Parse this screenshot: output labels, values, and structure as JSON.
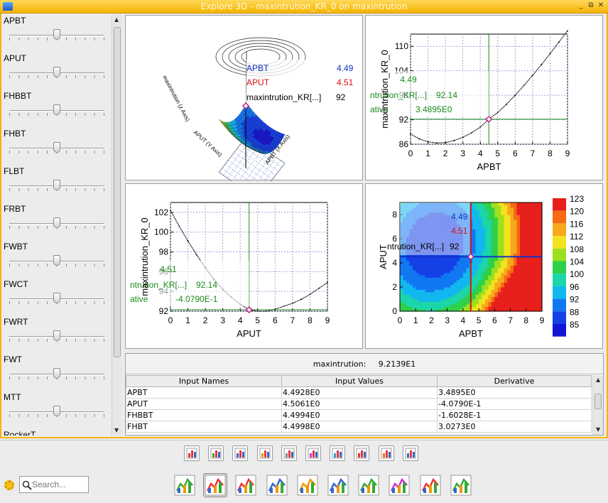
{
  "window": {
    "title": "Explore 3D - maxintrution_KR_0 on maxintrution",
    "accent": "#f5b400"
  },
  "sliders": [
    {
      "label": "APBT",
      "value_fraction": 0.5
    },
    {
      "label": "APUT",
      "value_fraction": 0.5
    },
    {
      "label": "FHBBT",
      "value_fraction": 0.5
    },
    {
      "label": "FHBT",
      "value_fraction": 0.5
    },
    {
      "label": "FLBT",
      "value_fraction": 0.5
    },
    {
      "label": "FRBT",
      "value_fraction": 0.5
    },
    {
      "label": "FWBT",
      "value_fraction": 0.5
    },
    {
      "label": "FWCT",
      "value_fraction": 0.5
    },
    {
      "label": "FWRT",
      "value_fraction": 0.5
    },
    {
      "label": "FWT",
      "value_fraction": 0.5
    },
    {
      "label": "MTT",
      "value_fraction": 0.5
    },
    {
      "label": "RockerT",
      "value_fraction": 0.5
    }
  ],
  "plot3d": {
    "axis_z": "maxintrution (z Axis)",
    "axis_y": "APUT (Y Axis)",
    "axis_x": "APBT (X Axis)",
    "tooltip": {
      "apbt_label": "APBT",
      "apbt_value": "4.49",
      "aput_label": "APUT",
      "aput_value": "4.51",
      "out_label": "maxintrution_KR[...]",
      "out_value": "92"
    }
  },
  "chart_data": [
    {
      "type": "line",
      "xlabel": "APBT",
      "ylabel": "maxintrution_KR_0",
      "xlim": [
        0,
        9
      ],
      "ylim": [
        86,
        113
      ],
      "xticks": [
        "0",
        "1",
        "2",
        "3",
        "4",
        "5",
        "6",
        "7",
        "8",
        "9"
      ],
      "yticks": [
        "86",
        "92",
        "98",
        "104",
        "110"
      ],
      "x": [
        0,
        0.5,
        1,
        1.5,
        2,
        2.5,
        3,
        3.5,
        4,
        4.49,
        5,
        5.5,
        6,
        6.5,
        7,
        7.5,
        8,
        8.5,
        9
      ],
      "y": [
        88.5,
        87.3,
        86.6,
        86.3,
        86.4,
        86.9,
        87.7,
        88.8,
        90.2,
        92.14,
        93.8,
        95.8,
        98.0,
        100.4,
        102.9,
        105.5,
        108.2,
        111.0,
        113.8
      ],
      "crosshair": {
        "x": 4.49,
        "y": 92.14
      },
      "annotation": {
        "top": "4.49",
        "middle_label": "ntrution_KR[...]",
        "middle_value": "92.14",
        "bottom_label": "ative",
        "bottom_value": "3.4895E0"
      }
    },
    {
      "type": "line",
      "xlabel": "APUT",
      "ylabel": "maxintrution_KR_0",
      "xlim": [
        0,
        9
      ],
      "ylim": [
        92,
        103
      ],
      "xticks": [
        "0",
        "1",
        "2",
        "3",
        "4",
        "5",
        "6",
        "7",
        "8",
        "9"
      ],
      "yticks": [
        "92",
        "94",
        "96",
        "98",
        "100",
        "102"
      ],
      "x": [
        0,
        0.5,
        1,
        1.5,
        2,
        2.5,
        3,
        3.5,
        4,
        4.51,
        5,
        5.5,
        6,
        6.5,
        7,
        7.5,
        8,
        8.5,
        9
      ],
      "y": [
        102.2,
        100.6,
        99.1,
        97.7,
        96.4,
        95.2,
        94.2,
        93.4,
        92.7,
        92.14,
        92.0,
        92.0,
        92.2,
        92.5,
        92.8,
        93.2,
        93.7,
        94.3,
        94.9
      ],
      "crosshair": {
        "x": 4.51,
        "y": 92.14
      },
      "annotation": {
        "top": "4.51",
        "middle_label": "ntrution_KR[...]",
        "middle_value": "92.14",
        "bottom_label": "ative",
        "bottom_value": "-4.0790E-1"
      }
    },
    {
      "type": "heatmap",
      "xlabel": "APBT",
      "ylabel": "APUT",
      "xlim": [
        0,
        9
      ],
      "ylim": [
        0,
        9
      ],
      "xticks": [
        "0",
        "1",
        "2",
        "3",
        "4",
        "5",
        "6",
        "7",
        "8",
        "9"
      ],
      "yticks": [
        "0",
        "2",
        "4",
        "6",
        "8"
      ],
      "crosshair": {
        "x": 4.49,
        "y": 4.51
      },
      "annotation": {
        "apbt": "4.49",
        "aput": "4.51",
        "out_label": "ntrution_KR[...]",
        "out_value": "92"
      },
      "colorbar": {
        "labels": [
          "123",
          "120",
          "116",
          "112",
          "108",
          "104",
          "100",
          "96",
          "92",
          "88",
          "85"
        ],
        "colors": [
          "#e8201c",
          "#f56a12",
          "#f7a81b",
          "#f3e21e",
          "#9ee01e",
          "#2fd04a",
          "#1bd6a8",
          "#12b7ef",
          "#1278f2",
          "#1440e6",
          "#1414d6"
        ]
      }
    }
  ],
  "result": {
    "label": "maxintrution:",
    "value": "9.2139E1"
  },
  "table": {
    "headers": [
      "Input Names",
      "Input Values",
      "Derivative"
    ],
    "rows": [
      [
        "APBT",
        "4.4928E0",
        "3.4895E0"
      ],
      [
        "APUT",
        "4.5061E0",
        "-4.0790E-1"
      ],
      [
        "FHBBT",
        "4.4994E0",
        "-1.6028E-1"
      ],
      [
        "FHBT",
        "4.4998E0",
        "3.0273E0"
      ]
    ]
  },
  "search": {
    "placeholder": "Search..."
  },
  "toolbar": {
    "row1_icons": [
      "table-icon",
      "grid-chart-icon",
      "scatter-matrix-icon",
      "scatter-matrix-2-icon",
      "parallel-plot-icon",
      "correlation-icon",
      "scatter-icon",
      "histogram-icon",
      "bubble-icon",
      "3d-bar-icon"
    ],
    "row2_icons": [
      "surface-icon",
      "histogram-tool-icon",
      "distribution-icon",
      "filter-icon",
      "area-icon",
      "bar-icon",
      "cluster-icon",
      "contour3d-icon",
      "pareto-icon",
      "network-icon"
    ]
  }
}
